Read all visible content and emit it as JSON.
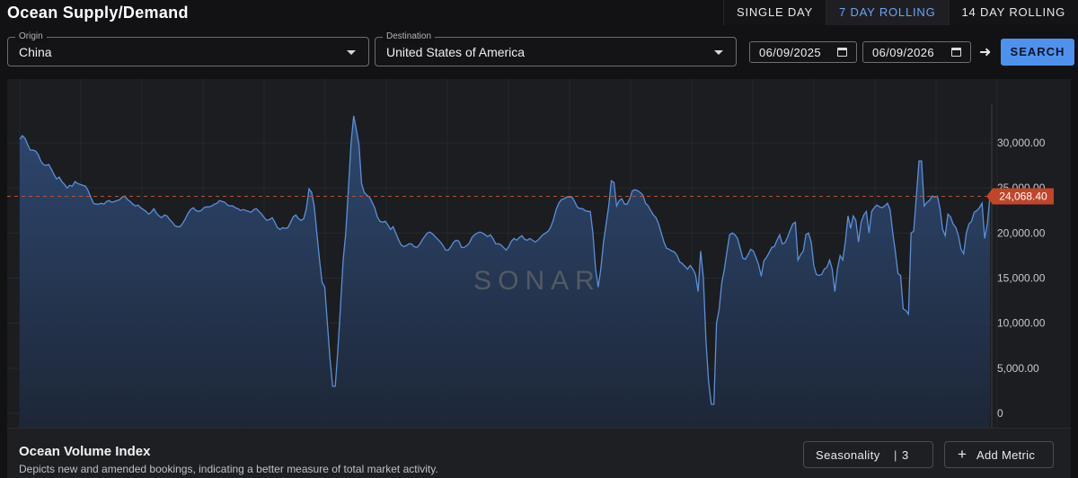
{
  "header": {
    "title": "Ocean Supply/Demand",
    "tabs": [
      {
        "label": "SINGLE DAY",
        "active": false
      },
      {
        "label": "7 DAY ROLLING",
        "active": true
      },
      {
        "label": "14 DAY ROLLING",
        "active": false
      }
    ]
  },
  "filters": {
    "origin": {
      "label": "Origin",
      "value": "China"
    },
    "destination": {
      "label": "Destination",
      "value": "United States of America"
    },
    "start_date": "06/09/2025",
    "end_date": "06/09/2026",
    "search_label": "SEARCH"
  },
  "icons": {
    "calendar": "calendar-icon",
    "arrow": "arrow-right-icon",
    "dropdown": "chevron-down-icon",
    "plus": "plus-icon"
  },
  "arrow_glyph": "➜",
  "colors": {
    "accent": "#4f92ee",
    "series_line": "#5b8fd9",
    "current_badge": "#c0452b",
    "background": "#121214"
  },
  "chart_data": {
    "type": "area",
    "watermark": "SONAR",
    "y_ticks": [
      "30,000.00",
      "25,000.00",
      "20,000.00",
      "15,000.00",
      "10,000.00",
      "5,000.00",
      "0"
    ],
    "ylim": [
      0,
      35000
    ],
    "grid": true,
    "current_value": 24068.4,
    "current_label": "24,068.40",
    "series": [
      {
        "values": [
          30400,
          30800,
          30500,
          29800,
          29200,
          29200,
          29100,
          28700,
          28000,
          27600,
          27500,
          27600,
          27100,
          26500,
          26000,
          26200,
          25700,
          25400,
          25000,
          25300,
          25200,
          25700,
          25500,
          25400,
          25300,
          25200,
          24700,
          24000,
          23300,
          23200,
          23200,
          23300,
          23200,
          23500,
          23600,
          23400,
          23500,
          23600,
          23700,
          24000,
          24100,
          23700,
          23500,
          23200,
          23000,
          23100,
          22800,
          22600,
          22400,
          22100,
          22300,
          22700,
          22200,
          21900,
          21700,
          22000,
          21900,
          21500,
          21200,
          20800,
          20700,
          20700,
          21100,
          21600,
          22200,
          22600,
          22800,
          22500,
          22400,
          22500,
          22800,
          22900,
          22900,
          23000,
          23200,
          23300,
          23600,
          23500,
          23400,
          23100,
          23000,
          23000,
          22800,
          22700,
          22500,
          22600,
          22500,
          22400,
          22300,
          22600,
          22700,
          22400,
          22100,
          21700,
          21400,
          21500,
          21700,
          21200,
          20600,
          20400,
          20600,
          20500,
          20600,
          21200,
          21800,
          22000,
          21600,
          21400,
          21600,
          22700,
          24900,
          24500,
          23000,
          20000,
          17000,
          14500,
          14000,
          10000,
          6000,
          3000,
          3000,
          7000,
          12000,
          17000,
          20000,
          25000,
          30000,
          33000,
          31500,
          29800,
          25500,
          24500,
          24200,
          24000,
          23400,
          22800,
          21800,
          21300,
          21200,
          21300,
          20900,
          20400,
          20700,
          20000,
          19300,
          18700,
          18500,
          18600,
          18800,
          18800,
          18500,
          18400,
          18700,
          19200,
          19600,
          20000,
          20100,
          19900,
          19600,
          19300,
          19000,
          18600,
          18100,
          18100,
          18500,
          19000,
          19200,
          19100,
          18400,
          18400,
          18600,
          18900,
          19500,
          19800,
          20000,
          20100,
          20000,
          19800,
          19600,
          19800,
          19400,
          18800,
          18800,
          18700,
          18400,
          18100,
          18500,
          19100,
          19400,
          19200,
          19500,
          19700,
          19300,
          19200,
          19400,
          19200,
          19000,
          19200,
          19500,
          19800,
          20000,
          20200,
          20700,
          21500,
          22600,
          23300,
          23700,
          23800,
          24000,
          24000,
          24000,
          23500,
          22900,
          22700,
          22700,
          22500,
          22400,
          22400,
          20000,
          16000,
          14000,
          16000,
          19000,
          21000,
          23000,
          25800,
          25600,
          23000,
          23600,
          23800,
          23200,
          23200,
          23800,
          24700,
          24800,
          24700,
          24500,
          24200,
          23300,
          23000,
          22500,
          22000,
          21700,
          21000,
          20000,
          19000,
          18300,
          18200,
          18000,
          17900,
          17500,
          16800,
          16600,
          16300,
          16000,
          16400,
          16000,
          15400,
          13500,
          18000,
          15000,
          8000,
          3500,
          1000,
          1000,
          10000,
          11500,
          14500,
          16000,
          18000,
          19800,
          20000,
          19800,
          19400,
          18300,
          17200,
          17100,
          17600,
          18200,
          18000,
          17300,
          16500,
          15200,
          16900,
          17300,
          17800,
          18400,
          18500,
          19200,
          19800,
          18800,
          18900,
          19500,
          20300,
          21000,
          21200,
          17000,
          17600,
          18000,
          19800,
          20000,
          19000,
          16400,
          15400,
          15300,
          15400,
          16000,
          16200,
          17000,
          16000,
          13500,
          16000,
          17500,
          17000,
          19000,
          21900,
          20500,
          21900,
          21400,
          19000,
          21200,
          22000,
          22400,
          20000,
          22400,
          22800,
          23100,
          22900,
          22800,
          23000,
          23300,
          22600,
          20100,
          18000,
          15500,
          15300,
          11600,
          11400,
          11000,
          20000,
          20200,
          24000,
          28000,
          28000,
          23000,
          23400,
          23600,
          24100,
          24000,
          24100,
          22700,
          20400,
          19700,
          22100,
          21800,
          21000,
          20600,
          19700,
          18200,
          17700,
          20000,
          21000,
          21300,
          22300,
          22500,
          22800,
          23300,
          19400,
          21000,
          24068
        ]
      }
    ]
  },
  "card": {
    "title": "Ocean Volume Index",
    "description": "Depicts new and amended bookings, indicating a better measure of total market activity.",
    "seasonality_label": "Seasonality",
    "seasonality_sep": "|",
    "seasonality_value": "3",
    "add_metric_plus": "+",
    "add_metric_label": "Add Metric"
  }
}
